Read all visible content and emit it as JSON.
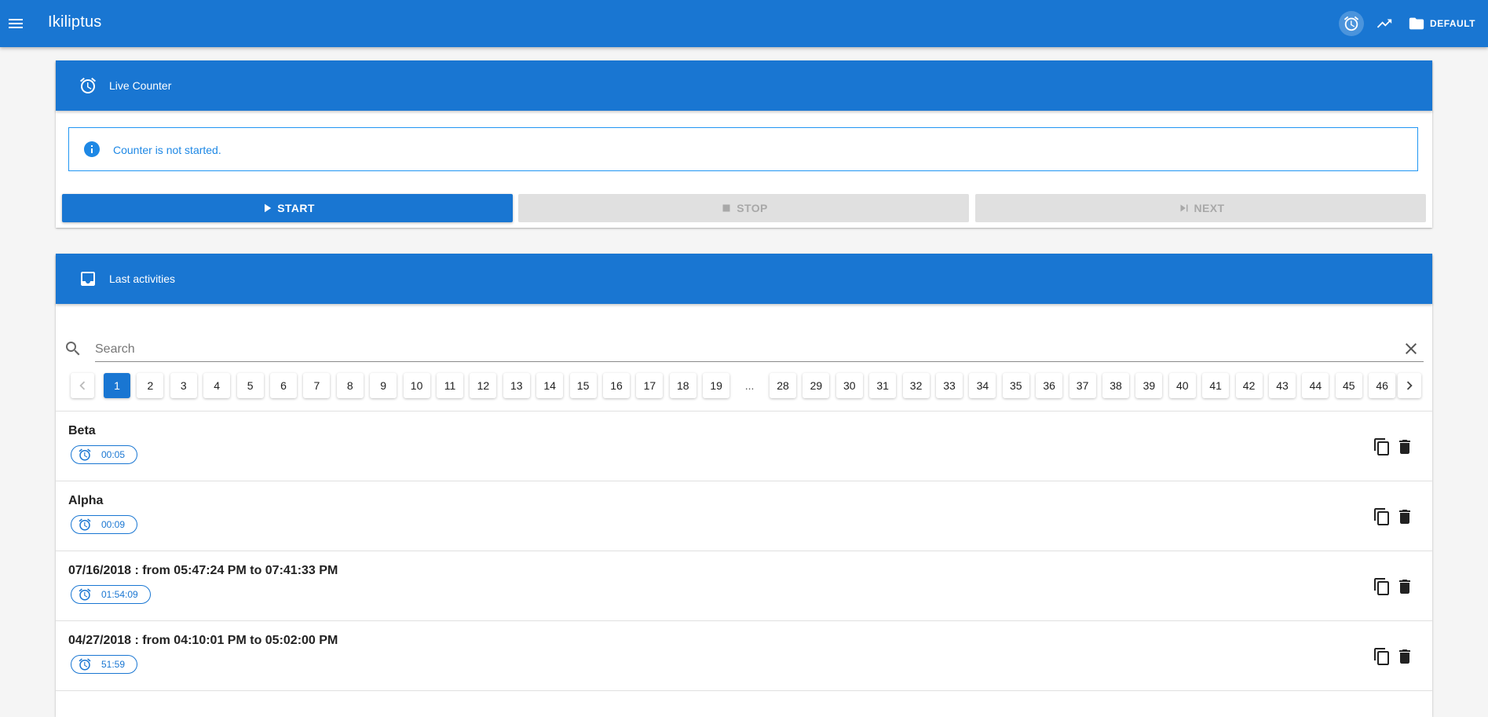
{
  "app": {
    "title": "Ikiliptus",
    "folder_label": "DEFAULT"
  },
  "live_counter": {
    "title": "Live Counter",
    "status_text": "Counter is not started.",
    "start_label": "START",
    "stop_label": "STOP",
    "next_label": "NEXT"
  },
  "activities": {
    "title": "Last activities",
    "search_placeholder": "Search",
    "search_value": "",
    "pages": [
      "1",
      "2",
      "3",
      "4",
      "5",
      "6",
      "7",
      "8",
      "9",
      "10",
      "11",
      "12",
      "13",
      "14",
      "15",
      "16",
      "17",
      "18",
      "19",
      "...",
      "28",
      "29",
      "30",
      "31",
      "32",
      "33",
      "34",
      "35",
      "36",
      "37",
      "38",
      "39",
      "40",
      "41",
      "42",
      "43",
      "44",
      "45",
      "46"
    ],
    "current_page": "1",
    "items": [
      {
        "title": "Beta",
        "duration": "00:05"
      },
      {
        "title": "Alpha",
        "duration": "00:09"
      },
      {
        "title": "07/16/2018 : from 05:47:24 PM to 07:41:33 PM",
        "duration": "01:54:09"
      },
      {
        "title": "04/27/2018 : from 04:10:01 PM to 05:02:00 PM",
        "duration": "51:59"
      }
    ]
  },
  "colors": {
    "primary": "#1976d2",
    "info": "#2196f3",
    "disabled": "#e0e0e0"
  },
  "icons": [
    "menu-icon",
    "alarm-icon",
    "trending-up-icon",
    "folder-icon",
    "info-icon",
    "play-icon",
    "stop-icon",
    "skip-next-icon",
    "inbox-icon",
    "search-icon",
    "close-icon",
    "chevron-left-icon",
    "chevron-right-icon",
    "copy-icon",
    "delete-icon"
  ]
}
